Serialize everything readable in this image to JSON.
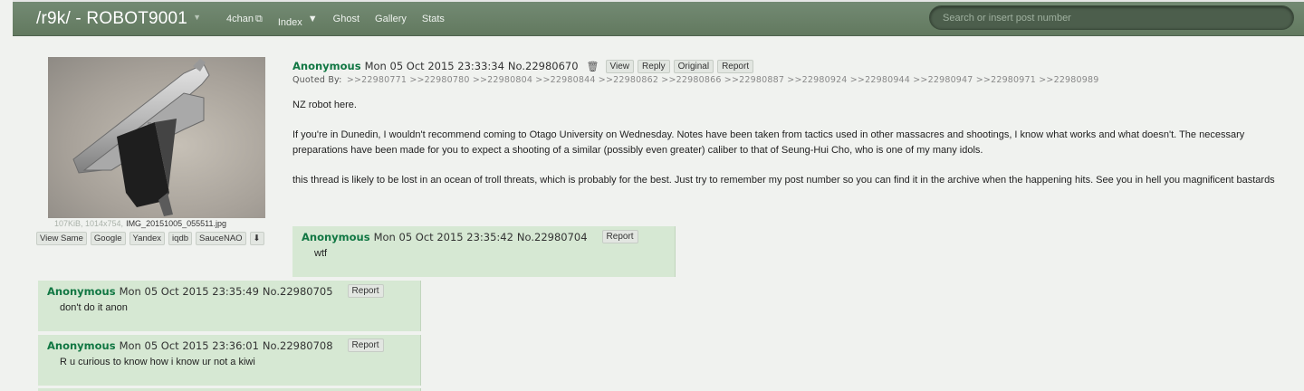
{
  "header": {
    "board_title": "/r9k/ - ROBOT9001",
    "nav": [
      "4chan",
      "Index",
      "Ghost",
      "Gallery",
      "Stats"
    ],
    "search_placeholder": "Search or insert post number"
  },
  "op": {
    "file": {
      "meta": "107KiB, 1014x754,",
      "filename": "IMG_20151005_055511.jpg",
      "search_buttons": [
        "View Same",
        "Google",
        "Yandex",
        "iqdb",
        "SauceNAO"
      ]
    },
    "name": "Anonymous",
    "date": "Mon 05 Oct 2015 23:33:34",
    "number": "No.22980670",
    "buttons": [
      "View",
      "Reply",
      "Original",
      "Report"
    ],
    "quoted_label": "Quoted By:",
    "quoted_by": ">>22980771 >>22980780 >>22980804 >>22980844 >>22980862 >>22980866 >>22980887 >>22980924 >>22980944 >>22980947 >>22980971 >>22980989",
    "paragraphs": [
      "NZ robot here.",
      "If you're in Dunedin, I wouldn't recommend coming to Otago University on Wednesday. Notes have been taken from tactics used in other massacres and shootings, I know what works and what doesn't. The necessary preparations have been made for you to expect a shooting of a similar (possibly even greater) caliber to that of Seung-Hui Cho, who is one of my many idols.",
      "this thread is likely to be lost in an ocean of troll threats, which is probably for the best. Just try to remember my post number so you can find it in the archive when the happening hits. See you in hell you magnificent bastards"
    ]
  },
  "replies": [
    {
      "name": "Anonymous",
      "date": "Mon 05 Oct 2015 23:35:42",
      "number": "No.22980704",
      "report": "Report",
      "text": "wtf"
    },
    {
      "name": "Anonymous",
      "date": "Mon 05 Oct 2015 23:35:49",
      "number": "No.22980705",
      "report": "Report",
      "text": "don't do it anon"
    },
    {
      "name": "Anonymous",
      "date": "Mon 05 Oct 2015 23:36:01",
      "number": "No.22980708",
      "report": "Report",
      "text": "R u curious to know how i know ur not a kiwi"
    }
  ],
  "colors": {
    "header": "#6b826b",
    "name": "#117743",
    "reply_bg": "#d6e8d3",
    "page_bg": "#f0f2ef"
  },
  "icons": [
    "external-link-icon",
    "chevron-down-icon",
    "trash-icon",
    "download-icon"
  ]
}
